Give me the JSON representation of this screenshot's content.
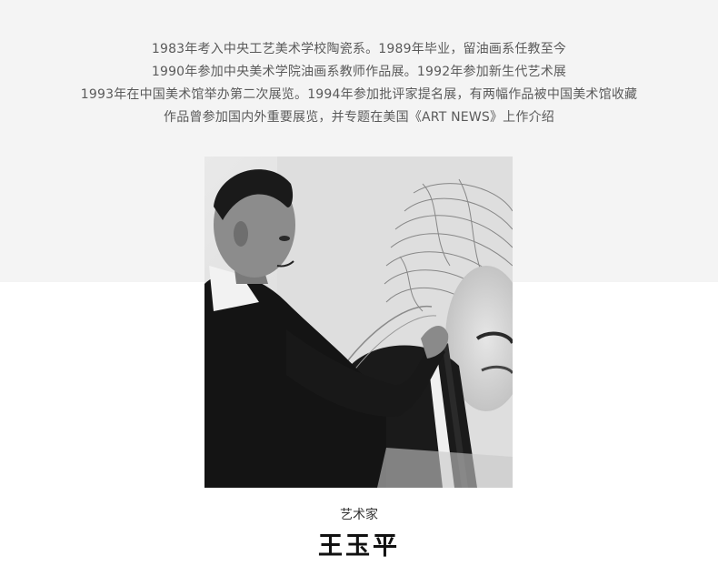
{
  "biography": {
    "lines": [
      "1983年考入中央工艺美术学校陶瓷系。1989年毕业，留油画系任教至今",
      "1990年参加中央美术学院油画系教师作品展。1992年参加新生代艺术展",
      "1993年在中国美术馆举办第二次展览。1994年参加批评家提名展，有两幅作品被中国美术馆收藏",
      "作品曾参加国内外重要展览，并专题在美国《ART NEWS》上作介绍"
    ]
  },
  "artist": {
    "label": "艺术家",
    "name": "王玉平"
  },
  "colors": {
    "top_band": "#f4f4f4",
    "body_text": "#5a5a5a",
    "name_text": "#111111"
  }
}
